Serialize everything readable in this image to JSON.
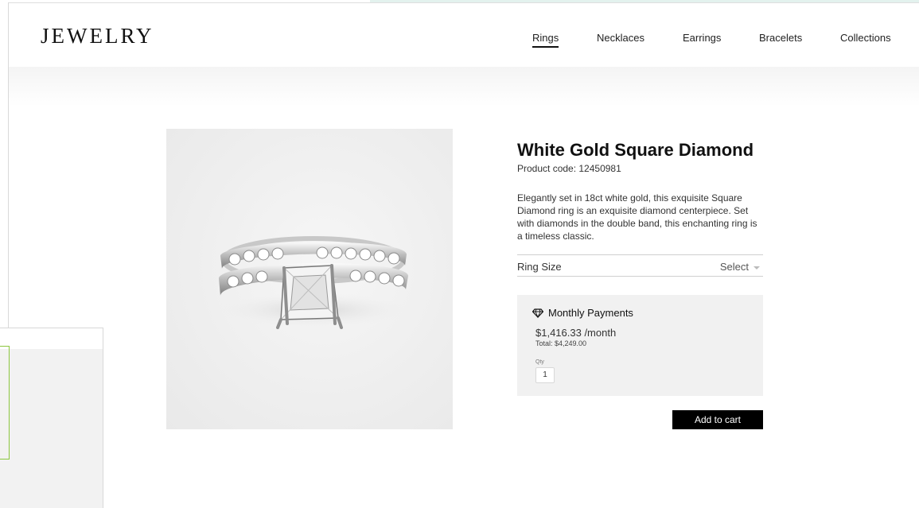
{
  "header": {
    "logo": "JEWELRY",
    "nav": [
      {
        "label": "Rings",
        "active": true
      },
      {
        "label": "Necklaces",
        "active": false
      },
      {
        "label": "Earrings",
        "active": false
      },
      {
        "label": "Bracelets",
        "active": false
      },
      {
        "label": "Collections",
        "active": false
      }
    ]
  },
  "product": {
    "title": "White Gold Square Diamond",
    "code": "Product code: 12450981",
    "description": "Elegantly set in 18ct white gold, this exquisite Square Diamond ring is an exquisite diamond centerpiece. Set with diamonds in the double band, this enchanting ring is a timeless classic.",
    "image_icon": "ring-photo"
  },
  "ring_size": {
    "label": "Ring Size",
    "select_value": "Select"
  },
  "payments": {
    "icon": "diamond-icon",
    "heading": "Monthly Payments",
    "monthly": "$1,416.33 /month",
    "total": "Total: $4,249.00",
    "qty_label": "Qty",
    "qty_value": "1"
  },
  "cart": {
    "button_label": "Add to cart"
  },
  "colors": {
    "accent": "#000000",
    "panel": "#f1f1f1",
    "selection_outline": "#8cc63f"
  }
}
